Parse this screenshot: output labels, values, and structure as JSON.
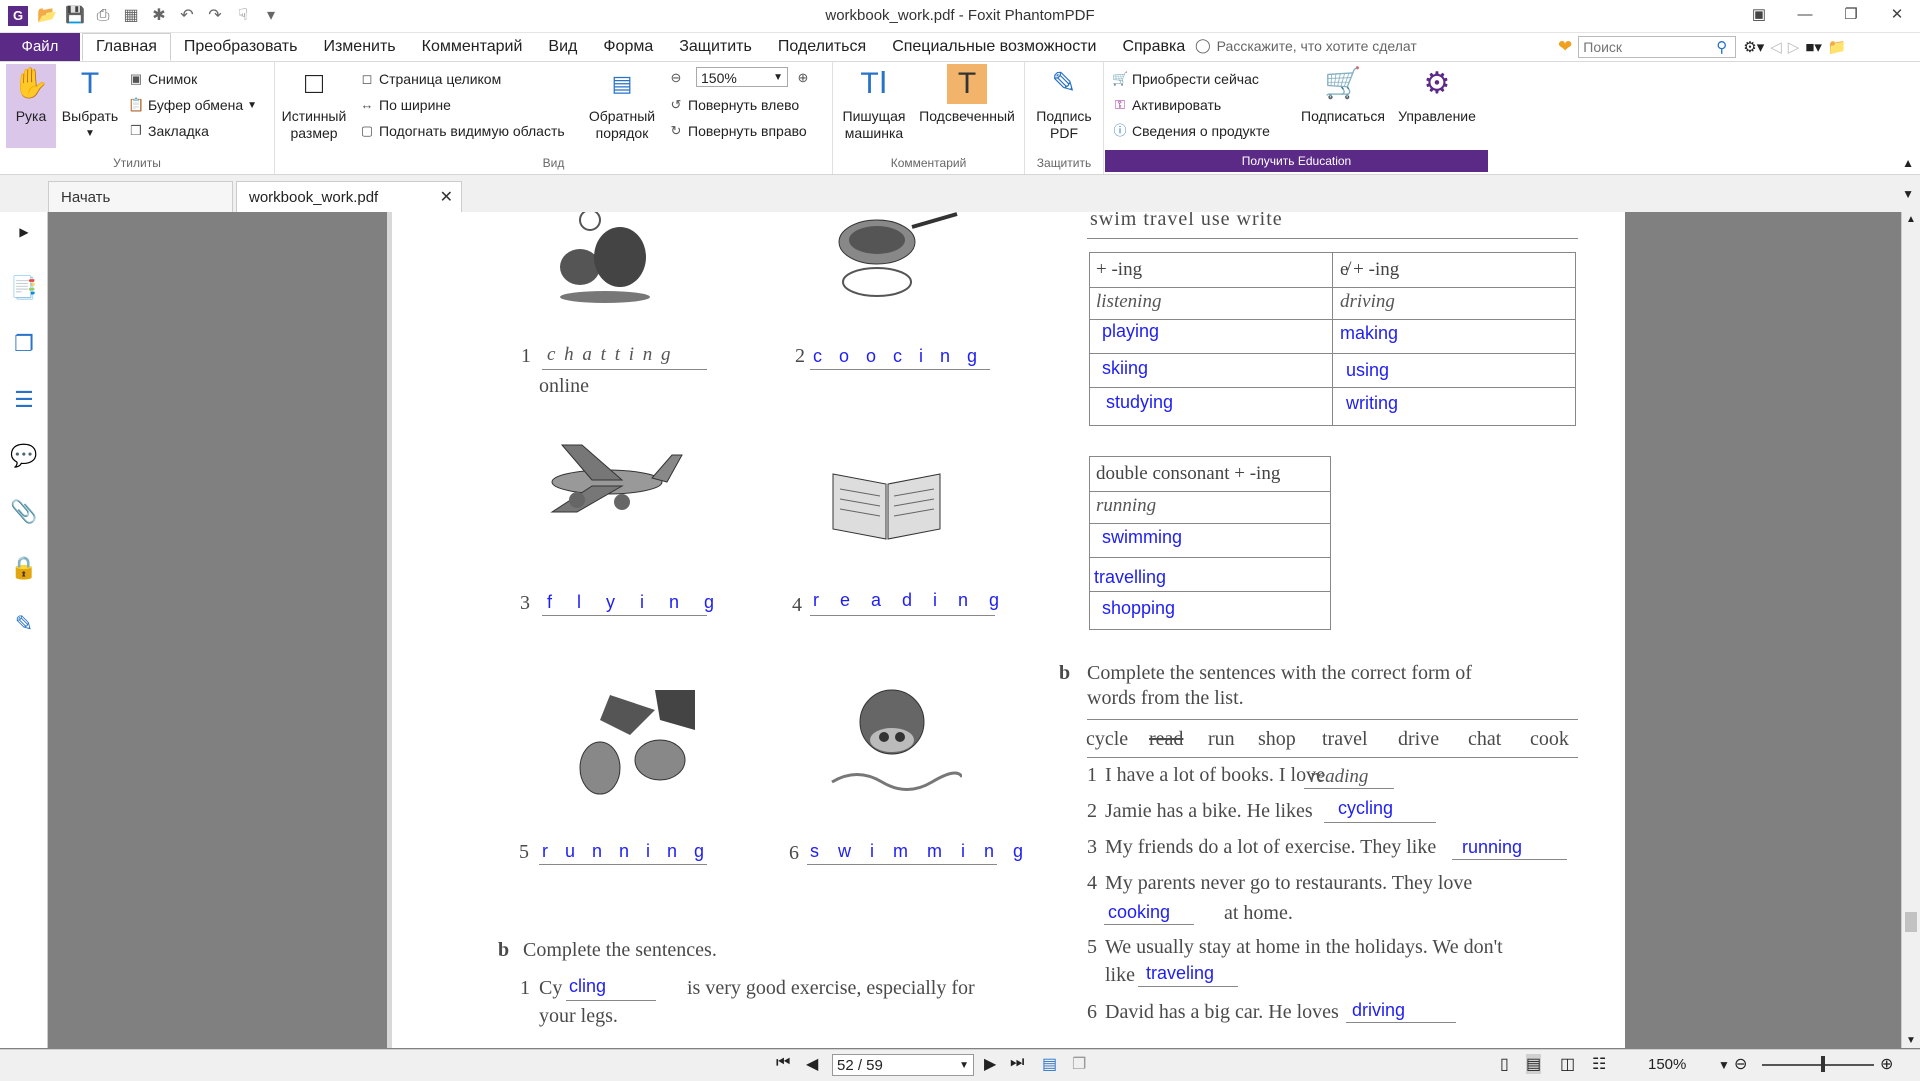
{
  "window": {
    "title": "workbook_work.pdf - Foxit PhantomPDF",
    "app_icon": "G"
  },
  "menu": {
    "file": "Файл",
    "tabs": [
      "Главная",
      "Преобразовать",
      "Изменить",
      "Комментарий",
      "Вид",
      "Форма",
      "Защитить",
      "Поделиться",
      "Специальные возможности",
      "Справка"
    ],
    "tell_me": "Расскажите, что хотите сделат",
    "search_placeholder": "Поиск"
  },
  "ribbon": {
    "hand": "Рука",
    "select": "Выбрать",
    "snapshot": "Снимок",
    "clipboard": "Буфер обмена",
    "bookmark": "Закладка",
    "utilities_label": "Утилиты",
    "actual_size_1": "Истинный",
    "actual_size_2": "размер",
    "fit_page": "Страница целиком",
    "fit_width": "По ширине",
    "fit_visible": "Подогнать видимую область",
    "reverse_1": "Обратный",
    "reverse_2": "порядок",
    "zoom_value": "150%",
    "rotate_left": "Повернуть влево",
    "rotate_right": "Повернуть вправо",
    "view_label": "Вид",
    "typewriter_1": "Пишущая",
    "typewriter_2": "машинка",
    "highlight": "Подсвеченный",
    "comment_label": "Комментарий",
    "sign_1": "Подпись",
    "sign_2": "PDF",
    "protect_label": "Защитить",
    "buy_now": "Приобрести сейчас",
    "activate": "Активировать",
    "product_info": "Сведения о продукте",
    "subscribe": "Подписаться",
    "manage": "Управление",
    "education": "Получить Education"
  },
  "tabs": {
    "start": "Начать",
    "doc": "workbook_work.pdf"
  },
  "status": {
    "page": "52 / 59",
    "zoom": "150%"
  },
  "page": {
    "item1_num": "1",
    "item1_word": "c h a t t i n g",
    "item1_extra": "online",
    "item2_num": "2",
    "item2_word": "c o o c i n g",
    "item3_num": "3",
    "item3_word": "f l y i n g",
    "item4_num": "4",
    "item4_word": "r e a d i n g",
    "item5_num": "5",
    "item5_word": "r u n n i n g",
    "item6_num": "6",
    "item6_word": "s w i m m i n g",
    "b_left_label": "b",
    "b_left_title": "Complete the sentences.",
    "b_left_1_num": "1",
    "b_left_1_pre": "Cy",
    "b_left_1_ans": "cling",
    "b_left_1_post": "is very good exercise, especially for",
    "b_left_1_post2": "your legs.",
    "top_words": "swim   travel   use   write",
    "t1_h1": "+ -ing",
    "t1_h2": "e̸ + -ing",
    "t1_col1": [
      "listening",
      "playing",
      "skiing",
      "studying"
    ],
    "t1_col2": [
      "driving",
      "making",
      "using",
      "writing"
    ],
    "t2_h": "double consonant + -ing",
    "t2_rows": [
      "running",
      "swimming",
      "travelling",
      "shopping"
    ],
    "b_right_label": "b",
    "b_right_title_1": "Complete the sentences with the correct form of",
    "b_right_title_2": "words from the list.",
    "wordlist": [
      "cycle",
      "read",
      "run",
      "shop",
      "travel",
      "drive",
      "chat",
      "cook"
    ],
    "s1_num": "1",
    "s1_text": "I have a lot of books. I love",
    "s1_ans": "reading",
    "s2_num": "2",
    "s2_text": "Jamie has a bike. He likes",
    "s2_ans": "cycling",
    "s3_num": "3",
    "s3_text": "My friends do a lot of exercise. They like",
    "s3_ans": "running",
    "s4_num": "4",
    "s4_text": "My parents never go to restaurants. They love",
    "s4_ans": "cooking",
    "s4_post": "at home.",
    "s5_num": "5",
    "s5_text": "We usually stay at home in the holidays. We don't",
    "s5_pre": "like",
    "s5_ans": "traveling",
    "s6_num": "6",
    "s6_text": "David has a big car. He loves",
    "s6_ans": "driving"
  }
}
